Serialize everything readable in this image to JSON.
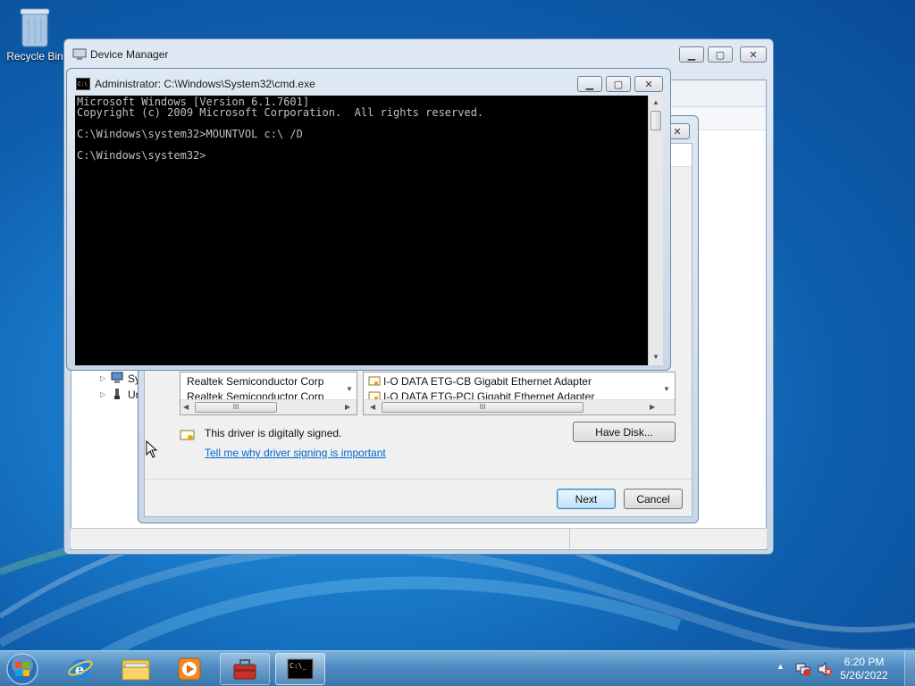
{
  "desktop": {
    "recycle_bin": "Recycle Bin"
  },
  "device_manager": {
    "title": "Device Manager",
    "tree_items": [
      "Sy",
      "Ur"
    ]
  },
  "wizard": {
    "manufacturers": [
      "Realtek Semiconductor Corp",
      "Realtek Semiconductor Corp"
    ],
    "models": [
      "I-O DATA ETG-CB Gigabit Ethernet Adapter",
      "I-O DATA ETG-PCI Gigabit Ethernet Adapter"
    ],
    "signed_text": "This driver is digitally signed.",
    "signing_link": "Tell me why driver signing is important",
    "have_disk": "Have Disk...",
    "next": "Next",
    "cancel": "Cancel",
    "scroll_grip": "III"
  },
  "cmd": {
    "title": "Administrator: C:\\Windows\\System32\\cmd.exe",
    "lines": [
      "Microsoft Windows [Version 6.1.7601]",
      "Copyright (c) 2009 Microsoft Corporation.  All rights reserved.",
      "",
      "C:\\Windows\\system32>MOUNTVOL c:\\ /D",
      "",
      "C:\\Windows\\system32>"
    ]
  },
  "taskbar": {
    "time": "6:20 PM",
    "date": "5/26/2022"
  },
  "icons": {
    "start": "windows-orb-icon",
    "ie": "internet-explorer-icon",
    "explorer": "folder-icon",
    "media": "media-player-icon",
    "toolbox": "toolbox-icon",
    "cmd": "cmd-icon"
  },
  "colors": {
    "console_bg": "#000000",
    "console_text": "#c0c0c0",
    "link": "#0066cc"
  }
}
